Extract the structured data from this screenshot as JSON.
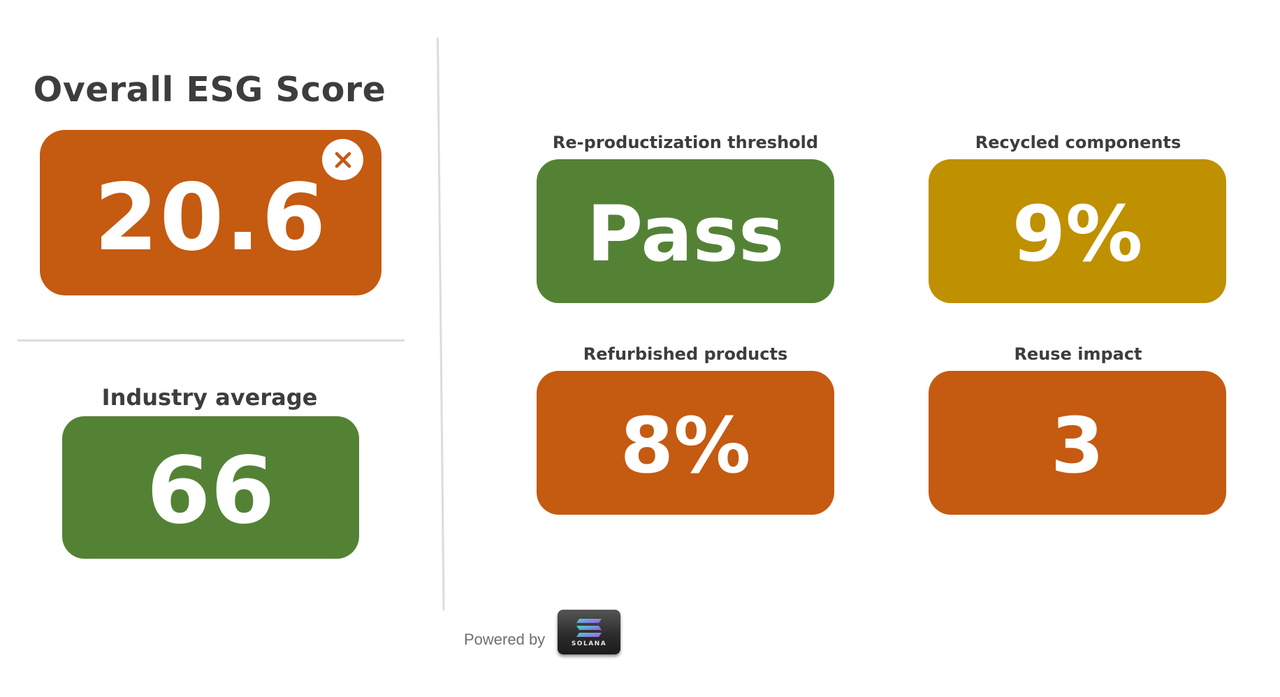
{
  "overall": {
    "title": "Overall ESG Score",
    "value": "20.6",
    "color": "#c55a11",
    "status_icon": "close-icon"
  },
  "industry": {
    "title": "Industry average",
    "value": "66",
    "color": "#548235"
  },
  "metrics": [
    {
      "label": "Re-productization threshold",
      "value": "Pass",
      "color": "#548235"
    },
    {
      "label": "Recycled components",
      "value": "9%",
      "color": "#bf9000"
    },
    {
      "label": "Refurbished products",
      "value": "8%",
      "color": "#c55a11"
    },
    {
      "label": "Reuse impact",
      "value": "3",
      "color": "#c55a11"
    }
  ],
  "footer": {
    "powered_by": "Powered by",
    "logo_text": "SOLANA"
  }
}
